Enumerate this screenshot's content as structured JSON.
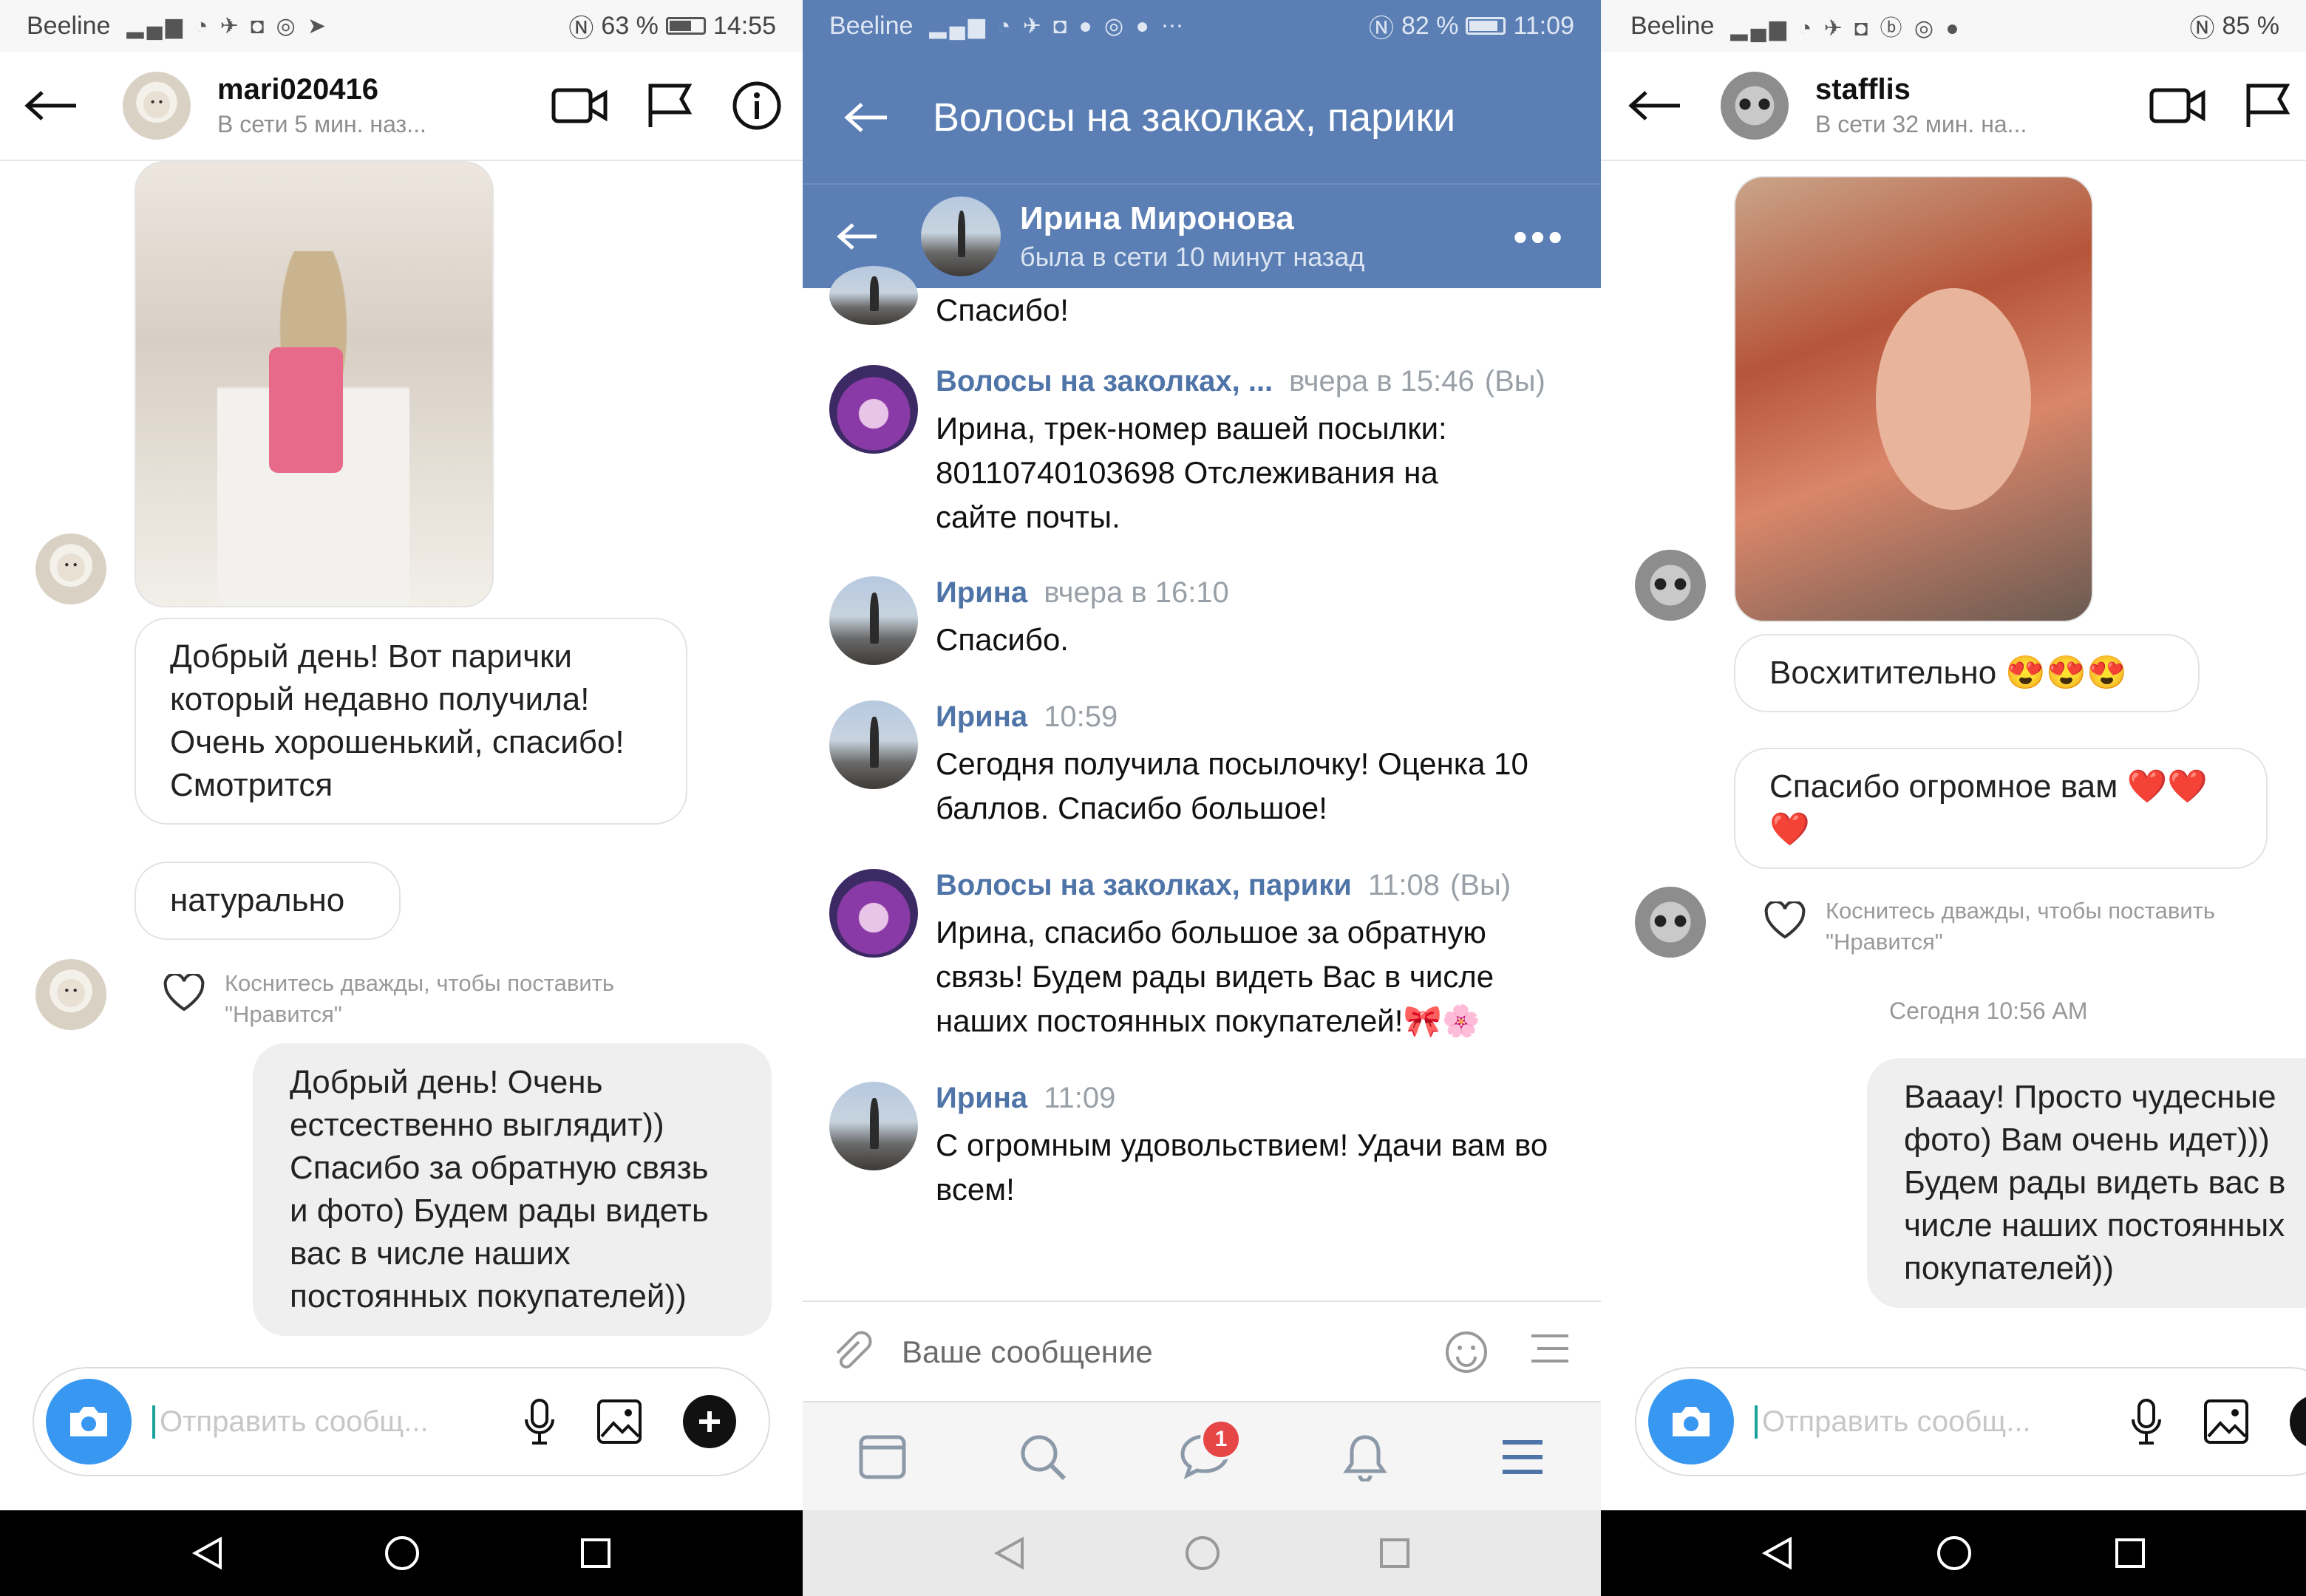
{
  "left": {
    "status": {
      "carrier": "Beeline",
      "battery": "63 %",
      "time": "14:55",
      "battery_level": 0.63
    },
    "header": {
      "username": "mari020416",
      "presence": "В сети 5 мин. наз..."
    },
    "messages": [
      "Добрый день! Вот парички который недавно получила! Очень хорошенький, спасибо! Смотрится",
      "натурально"
    ],
    "like_hint": "Коснитесь дважды, чтобы поставить \"Нравится\"",
    "reply": "Добрый день! Очень естсественно выглядит)) Спасибо за обратную связь и фото) Будем рады видеть вас в числе наших постоянных покупателей))",
    "composer_placeholder": "Отправить сообщ..."
  },
  "middle": {
    "status": {
      "carrier": "Beeline",
      "battery": "82 %",
      "time": "11:09",
      "battery_level": 0.82
    },
    "group_title": "Волосы на заколках, парики",
    "contact": {
      "name": "Ирина Миронова",
      "presence": "была в сети 10 минут назад"
    },
    "partial_message": "Спасибо!",
    "messages": [
      {
        "author": "Волосы на заколках, ...",
        "time": "вчера в 15:46",
        "suffix": "(Вы)",
        "text": "Ирина, трек-номер вашей посылки: 80110740103698 Отслеживания на сайте почты."
      },
      {
        "author": "Ирина",
        "time": "вчера в 16:10",
        "suffix": "",
        "text": "Спасибо."
      },
      {
        "author": "Ирина",
        "time": "10:59",
        "suffix": "",
        "text": "Сегодня получила посылочку! Оценка 10 баллов. Спасибо большое!"
      },
      {
        "author": "Волосы на заколках, парики",
        "time": "11:08",
        "suffix": "(Вы)",
        "text": "Ирина, спасибо большое за обратную связь! Будем рады видеть Вас в числе наших постоянных покупателей!🎀🌸"
      },
      {
        "author": "Ирина",
        "time": "11:09",
        "suffix": "",
        "text": "С огромным удовольствием! Удачи вам во всем!"
      }
    ],
    "input_placeholder": "Ваше сообщение",
    "unread_badge": "1"
  },
  "right": {
    "status": {
      "carrier": "Beeline",
      "battery": "85 %",
      "battery_level": 0.85
    },
    "header": {
      "username": "stafflis",
      "presence": "В сети 32 мин. на..."
    },
    "messages": [
      "Восхитительно 😍😍😍",
      "Спасибо огромное вам ❤️❤️ ❤️"
    ],
    "like_hint": "Коснитесь дважды, чтобы поставить \"Нравится\"",
    "timestamp": "Сегодня 10:56 AM",
    "reply": "Вааау! Просто чудесные фото) Вам очень идет))) Будем рады видеть вас в числе наших постоянных покупателей))",
    "composer_placeholder": "Отправить сообщ..."
  }
}
